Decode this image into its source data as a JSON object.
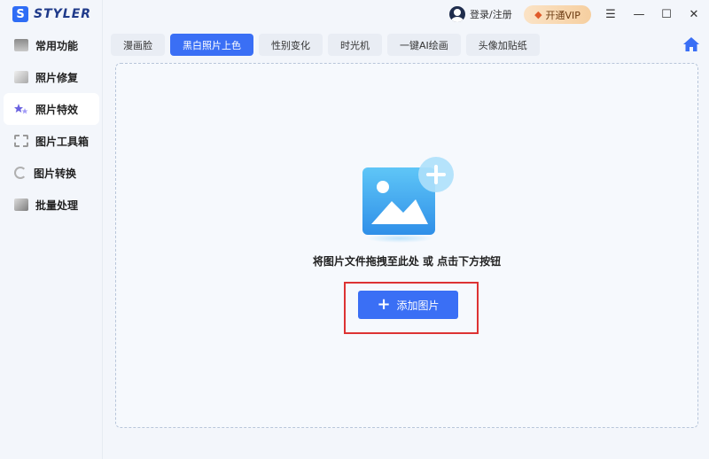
{
  "app": {
    "logo_letter": "S",
    "name": "STYLER"
  },
  "sidebar": {
    "items": [
      {
        "label": "常用功能",
        "icon": "common-functions-icon"
      },
      {
        "label": "照片修复",
        "icon": "photo-repair-icon"
      },
      {
        "label": "照片特效",
        "icon": "photo-effects-icon",
        "active": true
      },
      {
        "label": "图片工具箱",
        "icon": "image-toolbox-icon"
      },
      {
        "label": "图片转换",
        "icon": "image-convert-icon"
      },
      {
        "label": "批量处理",
        "icon": "batch-process-icon"
      }
    ]
  },
  "topbar": {
    "login_label": "登录/注册",
    "vip_label": "开通VIP",
    "window": {
      "menu": "☰",
      "minimize": "—",
      "maximize": "☐",
      "close": "✕"
    }
  },
  "tabs": [
    {
      "label": "漫画脸"
    },
    {
      "label": "黑白照片上色",
      "active": true
    },
    {
      "label": "性别变化"
    },
    {
      "label": "时光机"
    },
    {
      "label": "一键AI绘画"
    },
    {
      "label": "头像加贴纸"
    }
  ],
  "dropzone": {
    "hint": "将图片文件拖拽至此处 或 点击下方按钮",
    "add_button_label": "添加图片"
  },
  "colors": {
    "accent": "#3a6ff5",
    "highlight": "#d33333",
    "vip_bg": "#f6cfa0"
  }
}
